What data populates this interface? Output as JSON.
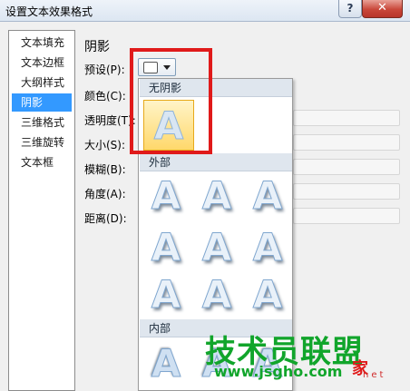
{
  "window": {
    "title": "设置文本效果格式",
    "help_label": "?",
    "close_label": "✕"
  },
  "nav": {
    "items": [
      "文本填充",
      "文本边框",
      "大纲样式",
      "阴影",
      "三维格式",
      "三维旋转",
      "文本框"
    ],
    "selected": "阴影"
  },
  "shadow_panel": {
    "heading": "阴影",
    "preset_label": "预设(P):",
    "color_label": "颜色(C):",
    "transparency_label": "透明度(T):",
    "size_label": "大小(S):",
    "blur_label": "模糊(B):",
    "angle_label": "角度(A):",
    "distance_label": "距离(D):"
  },
  "gallery": {
    "section_none": "无阴影",
    "section_outer": "外部",
    "section_inner": "内部",
    "glyph": "A"
  },
  "watermark": {
    "brand": "技术员联盟",
    "url": "www.jsgho.com",
    "red_text": "家",
    "net": "net"
  },
  "colors": {
    "highlight_red": "#e01a1a",
    "selection_blue": "#3399ff",
    "watermark_green": "#11a52b"
  }
}
